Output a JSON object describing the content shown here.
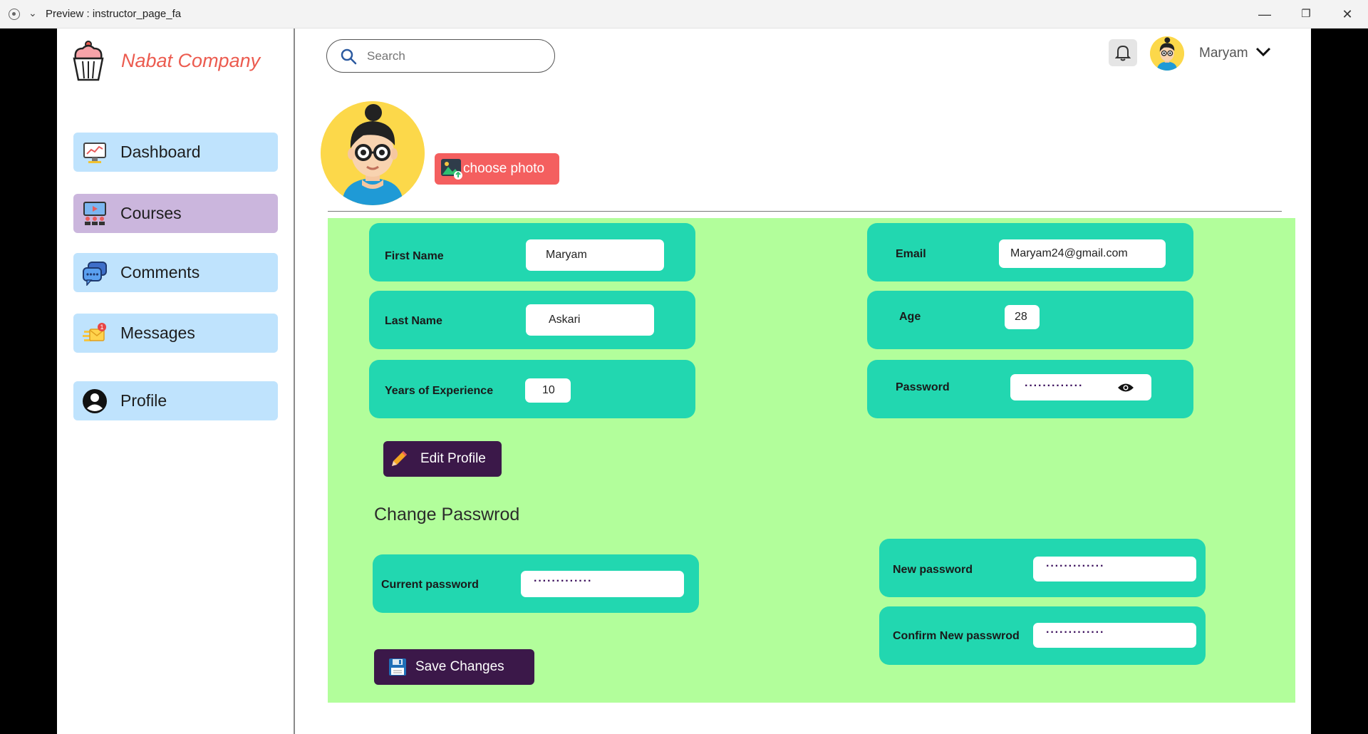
{
  "window": {
    "title": "Preview : instructor_page_fa"
  },
  "brand": {
    "name": "Nabat Company"
  },
  "sidebar": {
    "items": [
      {
        "label": "Dashboard",
        "icon": "dashboard-icon",
        "active": false
      },
      {
        "label": "Courses",
        "icon": "courses-icon",
        "active": true
      },
      {
        "label": "Comments",
        "icon": "comments-icon",
        "active": false
      },
      {
        "label": "Messages",
        "icon": "messages-icon",
        "active": false
      },
      {
        "label": "Profile",
        "icon": "profile-icon",
        "active": false
      }
    ]
  },
  "header": {
    "search_placeholder": "Search",
    "user_name": "Maryam"
  },
  "profile": {
    "choose_photo_label": "choose photo",
    "fields": {
      "first_name": {
        "label": "First Name",
        "value": "Maryam"
      },
      "last_name": {
        "label": "Last Name",
        "value": "Askari"
      },
      "experience": {
        "label": "Years of Experience",
        "value": "10"
      },
      "email": {
        "label": "Email",
        "value": "Maryam24@gmail.com"
      },
      "age": {
        "label": "Age",
        "value": "28"
      },
      "password": {
        "label": "Password",
        "value": "·············"
      }
    },
    "edit_button": "Edit Profile"
  },
  "change_password": {
    "title": "Change Passwrod",
    "current": {
      "label": "Current password",
      "value": "·············"
    },
    "new": {
      "label": "New password",
      "value": "·············"
    },
    "confirm": {
      "label": "Confirm New passwrod",
      "value": "·············"
    },
    "save_button": "Save Changes"
  },
  "colors": {
    "brand": "#ec5b4f",
    "nav_bg": "#bfe3fd",
    "nav_active": "#cbb6dd",
    "panel_bg": "#b2fe9b",
    "field_bg": "#22d7b0",
    "dark_button": "#3b1849",
    "choose_photo": "#f45f5f"
  }
}
